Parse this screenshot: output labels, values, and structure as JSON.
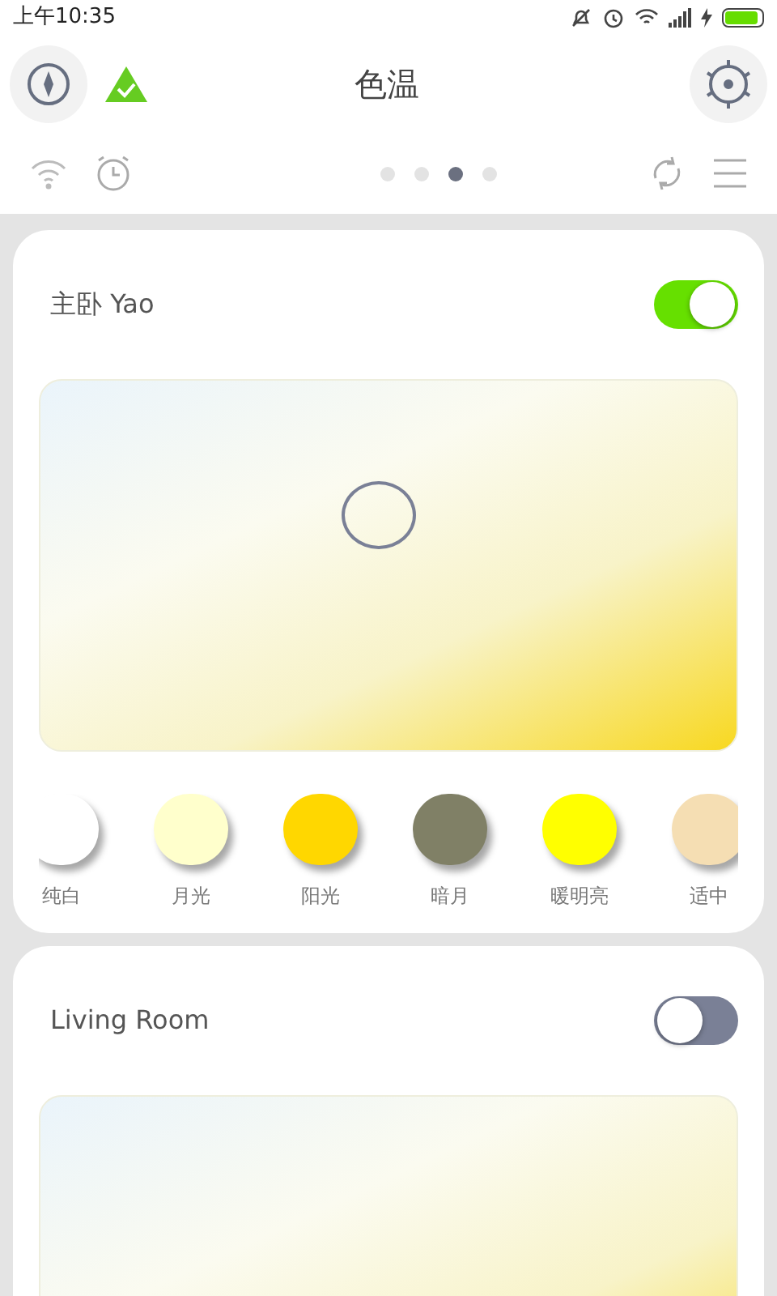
{
  "status_bar": {
    "time": "上午10:35"
  },
  "header": {
    "title": "色温"
  },
  "page_dots": [
    {
      "selected": false
    },
    {
      "selected": false
    },
    {
      "selected": true
    },
    {
      "selected": false
    }
  ],
  "rooms": [
    {
      "name": "主卧 Yao",
      "on": true,
      "show_marker": true,
      "presets": [
        {
          "label": "纯白",
          "color": "#ffffff"
        },
        {
          "label": "月光",
          "color": "#ffffcc"
        },
        {
          "label": "阳光",
          "color": "#ffd700"
        },
        {
          "label": "暗月",
          "color": "#808066"
        },
        {
          "label": "暖明亮",
          "color": "#ffff00"
        },
        {
          "label": "适中",
          "color": "#f5deb3"
        }
      ]
    },
    {
      "name": "Living Room",
      "on": false,
      "show_marker": false
    }
  ]
}
